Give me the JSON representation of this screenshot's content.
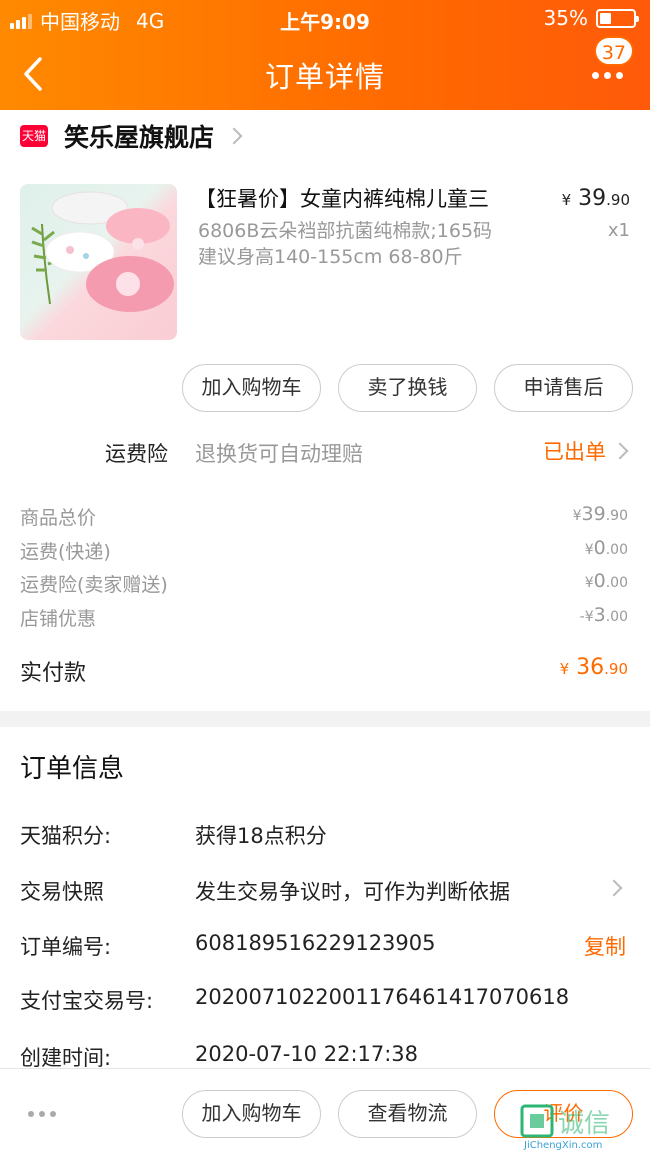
{
  "status_bar": {
    "carrier": "中国移动",
    "network": "4G",
    "time": "上午9:09",
    "battery": "35%",
    "battery_level": 0.35
  },
  "nav": {
    "title": "订单详情",
    "badge_count": "37"
  },
  "shop": {
    "badge": "天猫",
    "name": "笑乐屋旗舰店"
  },
  "product": {
    "title": "【狂暑价】女童内裤纯棉儿童三",
    "sku_line1": "6806B云朵裆部抗菌纯棉款;165码",
    "sku_line2": "建议身高140-155cm 68-80斤",
    "price_yen": "¥",
    "price_int": "39",
    "price_dec": ".90",
    "qty": "x1"
  },
  "item_actions": {
    "add_cart": "加入购物车",
    "resell": "卖了换钱",
    "after_sale": "申请售后"
  },
  "insurance": {
    "label": "运费险",
    "desc": "退换货可自动理赔",
    "status": "已出单"
  },
  "costs": [
    {
      "label": "商品总价",
      "prefix": "¥",
      "int": "39",
      "dec": ".90"
    },
    {
      "label": "运费(快递)",
      "prefix": "¥",
      "int": "0",
      "dec": ".00"
    },
    {
      "label": "运费险(卖家赠送)",
      "prefix": "¥",
      "int": "0",
      "dec": ".00"
    },
    {
      "label": "店铺优惠",
      "prefix": "-¥",
      "int": "3",
      "dec": ".00"
    }
  ],
  "total": {
    "label": "实付款",
    "prefix": "¥",
    "int": "36",
    "dec": ".90"
  },
  "order_info": {
    "title": "订单信息",
    "rows": [
      {
        "label": "天猫积分:",
        "value": "获得18点积分"
      },
      {
        "label": "交易快照",
        "value": "发生交易争议时，可作为判断依据"
      },
      {
        "label": "订单编号:",
        "value": "608189516229123905",
        "action": "复制"
      },
      {
        "label": "支付宝交易号:",
        "value": "2020071022001176461417070618"
      },
      {
        "label": "创建时间:",
        "value": "2020-07-10 22:17:38"
      }
    ]
  },
  "bottom_bar": {
    "add_cart": "加入购物车",
    "logistics": "查看物流",
    "review": "评价"
  },
  "watermark": {
    "text": "诚信",
    "url": "JiChengXin.com"
  },
  "colors": {
    "accent": "#ff6a00",
    "tmall_red": "#ff0036"
  }
}
